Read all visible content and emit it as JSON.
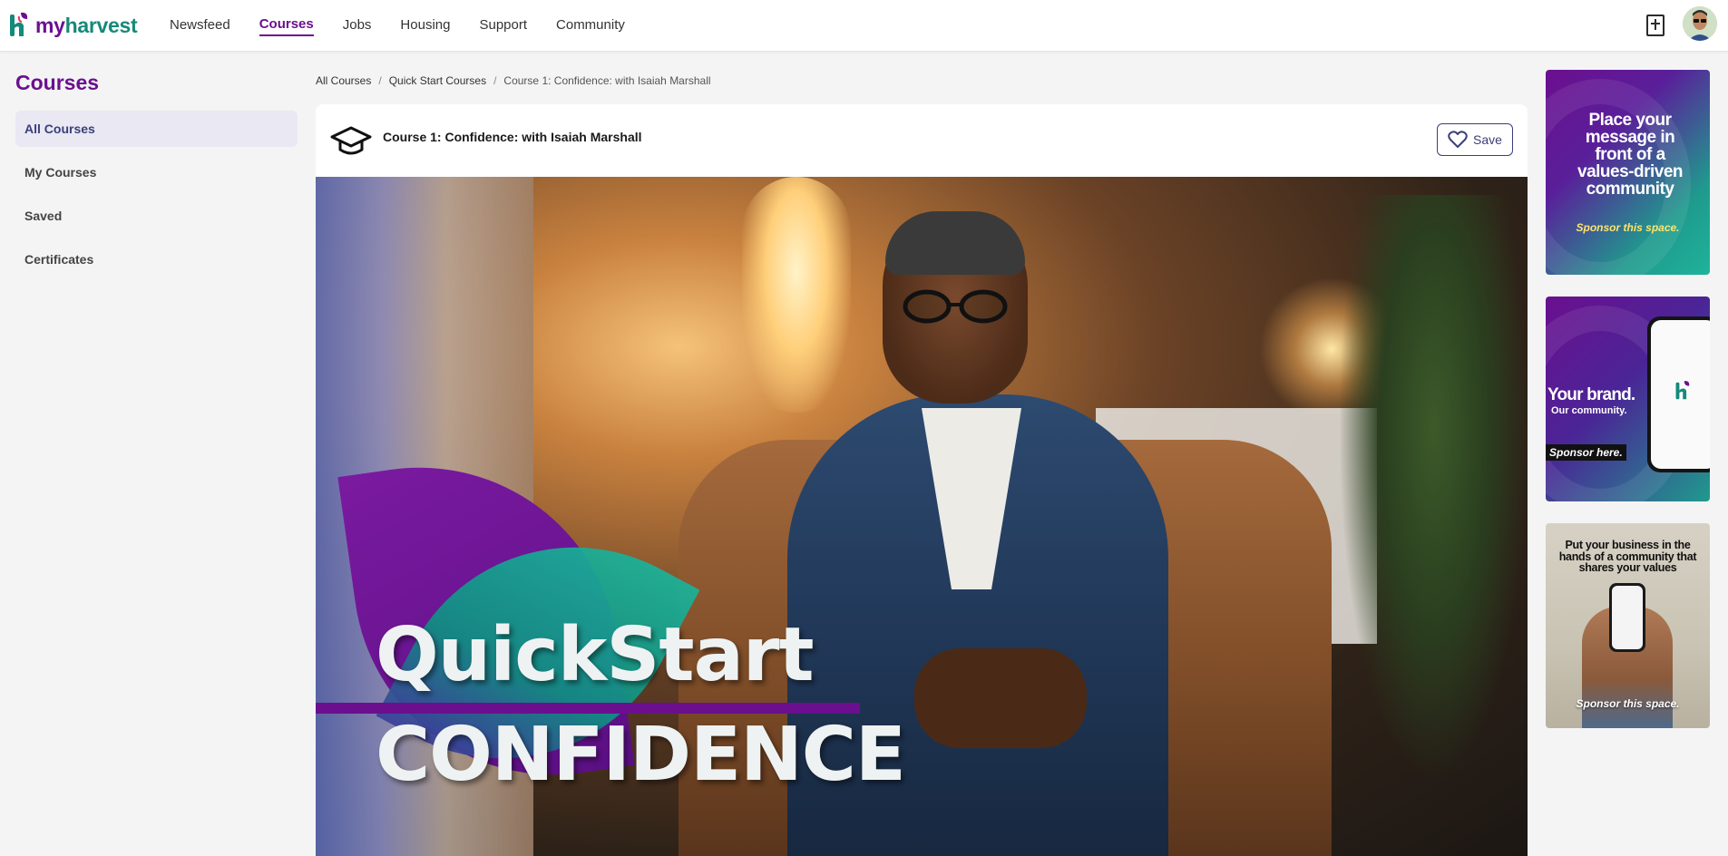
{
  "app": {
    "logo_my": "my",
    "logo_harvest": "harvest",
    "brand_purple": "#6b0f8f",
    "brand_teal": "#15897a"
  },
  "nav": {
    "items": [
      {
        "label": "Newsfeed",
        "active": false
      },
      {
        "label": "Courses",
        "active": true
      },
      {
        "label": "Jobs",
        "active": false
      },
      {
        "label": "Housing",
        "active": false
      },
      {
        "label": "Support",
        "active": false
      },
      {
        "label": "Community",
        "active": false
      }
    ],
    "bible_icon": "bible-icon",
    "avatar_icon": "user-avatar"
  },
  "sidebar": {
    "title": "Courses",
    "items": [
      {
        "label": "All Courses",
        "active": true
      },
      {
        "label": "My Courses",
        "active": false
      },
      {
        "label": "Saved",
        "active": false
      },
      {
        "label": "Certificates",
        "active": false
      }
    ]
  },
  "breadcrumb": {
    "items": [
      "All Courses",
      "Quick Start Courses",
      "Course 1: Confidence: with Isaiah Marshall"
    ],
    "separator": "/"
  },
  "course": {
    "icon": "graduation-cap-icon",
    "title": "Course 1: Confidence: with Isaiah Marshall",
    "save_label": "Save",
    "save_icon": "heart-icon",
    "thumbnail": {
      "line1": "QuickStart",
      "line2": "CONFIDENCE"
    }
  },
  "ads": [
    {
      "text": "Place your message in front of a values-driven community",
      "cta": "Sponsor this space."
    },
    {
      "title": "Your brand.",
      "subtitle": "Our community.",
      "cta": "Sponsor here."
    },
    {
      "text": "Put your business in the hands of a community that shares your values",
      "cta": "Sponsor this space."
    }
  ]
}
